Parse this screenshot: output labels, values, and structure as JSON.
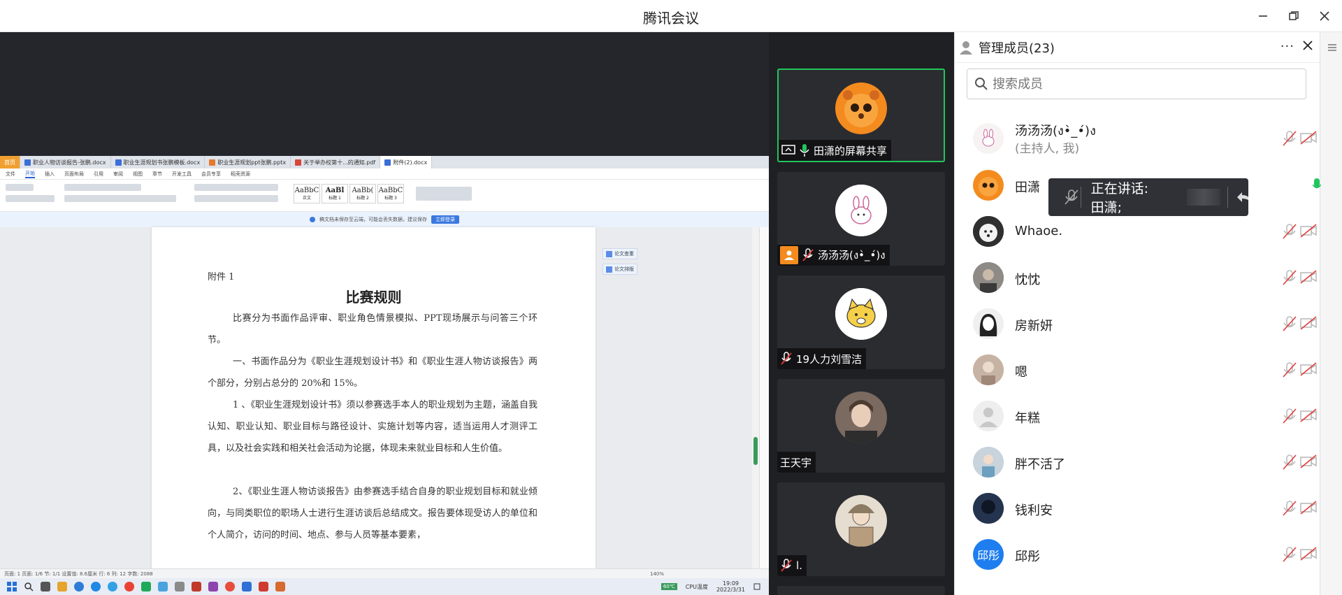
{
  "window": {
    "title": "腾讯会议"
  },
  "document": {
    "tabs": [
      {
        "label": "首页",
        "kind": "home"
      },
      {
        "label": "职业人物访谈报告-张鹏.docx",
        "kind": "doc"
      },
      {
        "label": "职业生涯规划书张鹏模板.docx",
        "kind": "doc"
      },
      {
        "label": "职业生涯规划ppt张鹏.pptx",
        "kind": "ppt"
      },
      {
        "label": "关于举办校第十...的通知.pdf",
        "kind": "pdf"
      },
      {
        "label": "附件(2).docx",
        "kind": "doc",
        "active": true
      }
    ],
    "menu": [
      "文件",
      "开始",
      "插入",
      "页面布局",
      "引用",
      "审阅",
      "视图",
      "章节",
      "开发工具",
      "会员专享",
      "稻壳资源"
    ],
    "menu_selected": "开始",
    "styles": [
      {
        "sample": "AaBbC",
        "label": "正文"
      },
      {
        "sample": "AaBl",
        "label": "标题 1"
      },
      {
        "sample": "AaBb(",
        "label": "标题 2"
      },
      {
        "sample": "AaBbC",
        "label": "标题 3"
      }
    ],
    "notice": "稿文档未保存至云端，可能会丢失数据，建议保存",
    "notice_button": "立即登录",
    "side_buttons": [
      "论文查重",
      "论文排版"
    ],
    "page": {
      "attachment": "附件 1",
      "heading": "比赛规则",
      "paragraphs": [
        "比赛分为书面作品评审、职业角色情景模拟、PPT现场展示与问答三个环节。",
        "一、书面作品分为《职业生涯规划设计书》和《职业生涯人物访谈报告》两个部分，分别占总分的 20%和 15%。",
        "1 、《职业生涯规划设计书》须以参赛选手本人的职业规划为主题，涵盖自我认知、职业认知、职业目标与路径设计、实施计划等内容，适当运用人才测评工具，以及社会实践和相关社会活动为论据，体现未来就业目标和人生价值。",
        "2、《职业生涯人物访谈报告》由参赛选手结合自身的职业规划目标和就业倾向，与同类职位的职场人士进行生涯访谈后总结成文。报告要体现受访人的单位和个人简介，访问的时间、地点、参与人员等基本要素，"
      ]
    },
    "status_left": "页面: 1  页面: 1/6  节: 1/1  设置值: 8.6厘米  行: 6  列: 12  字数: 2088",
    "status_right": "140%",
    "clock_time": "19:09",
    "clock_date": "2022/3/31",
    "cpu_label": "CPU温度"
  },
  "video": {
    "tiles": [
      {
        "name": "田潇的屏幕共享",
        "mic": "on",
        "screen_share": true,
        "active": true,
        "avatar_color": "#f48b1f"
      },
      {
        "name": "汤汤汤(ง•̀_•́)ง",
        "mic": "off",
        "host": true,
        "avatar_color": "#ffffff"
      },
      {
        "name": "19人力刘雪洁",
        "mic": "off",
        "avatar_color": "#f5d048"
      },
      {
        "name": "王天宇",
        "mic": "none",
        "avatar_color": "#7b6a60"
      },
      {
        "name": "l.",
        "mic": "off",
        "avatar_color": "#c2b49e"
      }
    ]
  },
  "members": {
    "title": "管理成员(23)",
    "search_placeholder": "搜索成员",
    "host_role": "(主持人, 我)",
    "list": [
      {
        "name": "汤汤汤(ง•̀_•́)ง",
        "mic": "off",
        "video": "off",
        "avatar_color": "#f7f3f3"
      },
      {
        "name": "田潇",
        "mic": "on",
        "video": "off",
        "avatar_color": "#f48b1f"
      },
      {
        "name": "Whaoe.",
        "mic": "off",
        "video": "off",
        "avatar_color": "#2f2f2f"
      },
      {
        "name": "忱忱",
        "mic": "off",
        "video": "off",
        "avatar_color": "#8e8a86"
      },
      {
        "name": "房新妍",
        "mic": "off",
        "video": "off",
        "avatar_color": "#efefef"
      },
      {
        "name": "嗯",
        "mic": "off",
        "video": "off",
        "avatar_color": "#c7b3a3"
      },
      {
        "name": "年糕",
        "mic": "off",
        "video": "off",
        "avatar_color": "#eeeeee"
      },
      {
        "name": "胖不活了",
        "mic": "off",
        "video": "off",
        "avatar_color": "#c8d3dc"
      },
      {
        "name": "钱利安",
        "mic": "off",
        "video": "off",
        "avatar_color": "#24344f"
      },
      {
        "name": "邱彤",
        "mic": "off",
        "video": "off",
        "avatar_color": "#1e7ef0",
        "initials": "邱彤"
      }
    ]
  },
  "speaking": {
    "label": "正在讲话: 田潇;"
  }
}
